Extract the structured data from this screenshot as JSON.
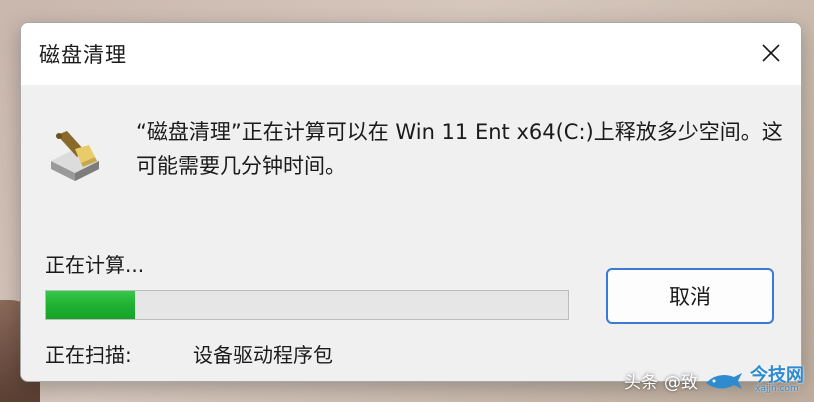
{
  "window": {
    "title": "磁盘清理",
    "close_icon": "close-icon"
  },
  "main": {
    "message": "“磁盘清理”正在计算可以在 Win 11 Ent x64(C:)上释放多少空间。这可能需要几分钟时间。",
    "status_label": "正在计算...",
    "progress_percent": 17,
    "progress_color": "#20b032",
    "scan_label": "正在扫描:",
    "scan_value": "设备驱动程序包",
    "cancel_label": "取消",
    "app_icon": "disk-cleanup-icon"
  },
  "watermark": {
    "prefix": "头条",
    "handle": "@致",
    "brand_main": "今技网",
    "brand_sub": "xajjn.com"
  }
}
